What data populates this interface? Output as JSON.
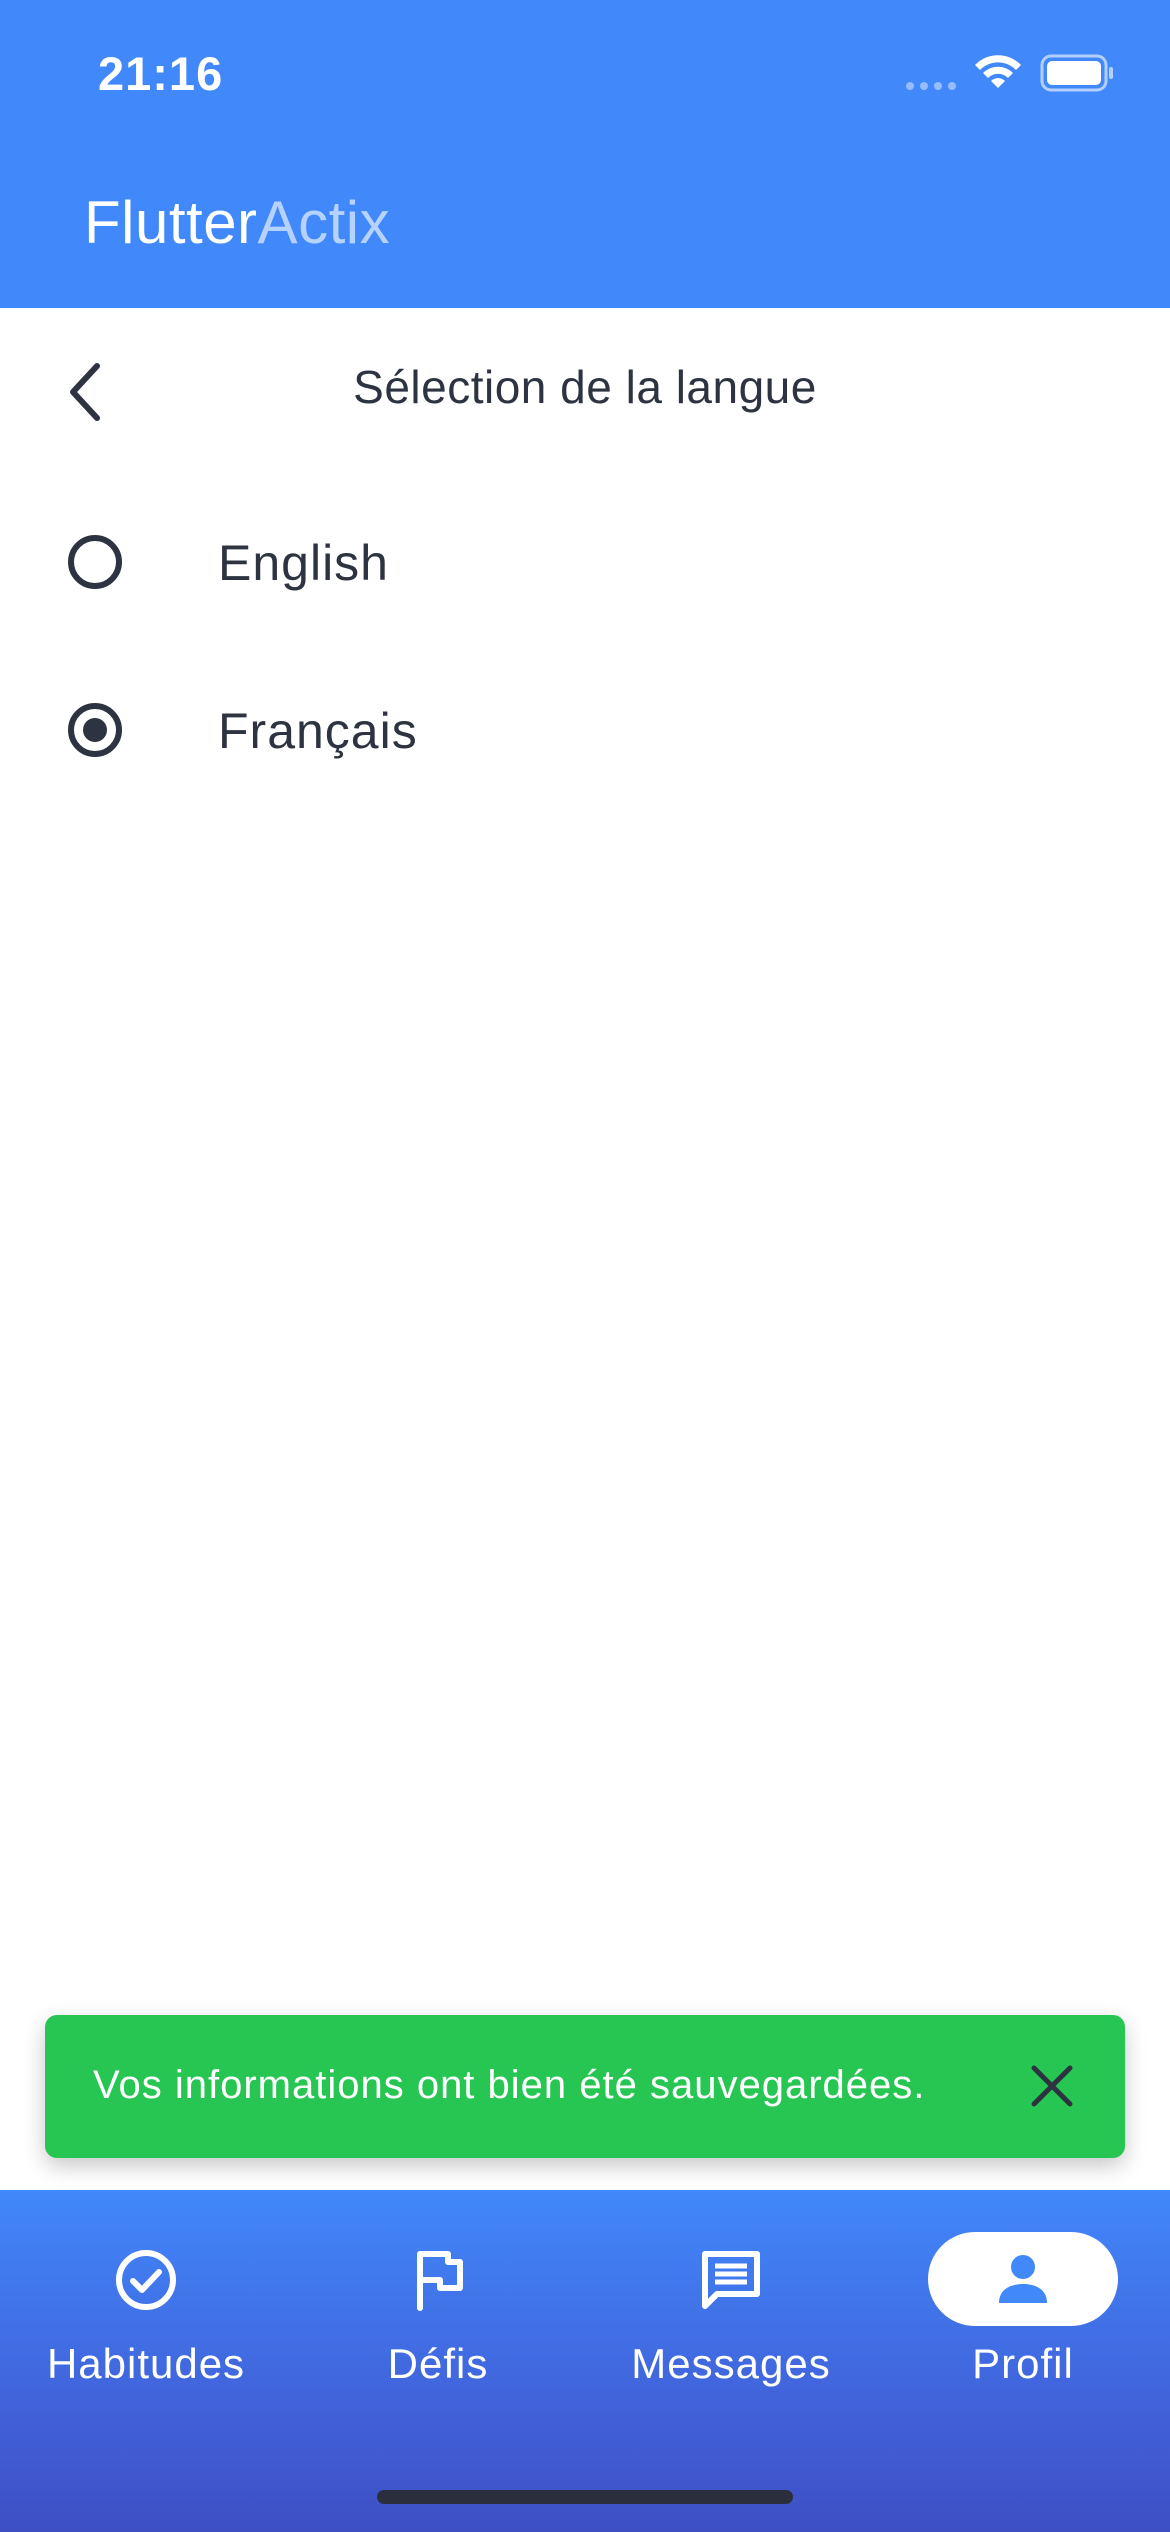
{
  "status_bar": {
    "time": "21:16"
  },
  "app_bar": {
    "title_part1": "Flutter",
    "title_part2": "Actix"
  },
  "page": {
    "title": "Sélection de la langue",
    "back_icon": "chevron-left-icon"
  },
  "languages": {
    "options": [
      {
        "label": "English",
        "selected": false
      },
      {
        "label": "Français",
        "selected": true
      }
    ]
  },
  "snackbar": {
    "message": "Vos informations ont bien été sauvegardées.",
    "close_icon": "close-icon",
    "color": "#27C653"
  },
  "bottom_nav": {
    "items": [
      {
        "label": "Habitudes",
        "icon": "check-circle-icon",
        "active": false
      },
      {
        "label": "Défis",
        "icon": "flag-icon",
        "active": false
      },
      {
        "label": "Messages",
        "icon": "message-icon",
        "active": false
      },
      {
        "label": "Profil",
        "icon": "person-icon",
        "active": true
      }
    ]
  },
  "colors": {
    "primary": "#4188FB",
    "text_dark": "#2D3340",
    "success": "#27C653"
  }
}
